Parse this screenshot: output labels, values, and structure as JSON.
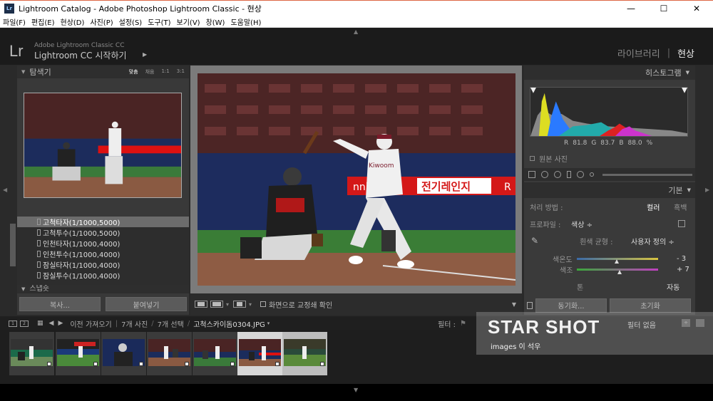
{
  "window": {
    "icon_text": "Lr",
    "title": "Lightroom Catalog - Adobe Photoshop Lightroom Classic - 현상",
    "minimize": "—",
    "maximize": "☐",
    "close": "✕"
  },
  "menu": [
    "파일(F)",
    "편집(E)",
    "현상(D)",
    "사진(P)",
    "설정(S)",
    "도구(T)",
    "보기(V)",
    "창(W)",
    "도움말(H)"
  ],
  "identity": {
    "logo": "Lr",
    "line1": "Adobe Lightroom Classic CC",
    "line2": "Lightroom CC 시작하기",
    "arrow": "▶"
  },
  "modules": {
    "library": "라이브러리",
    "separator": "|",
    "develop": "현상"
  },
  "navigator": {
    "title": "탐색기",
    "zoom_options": [
      "맞춤",
      "채움",
      "1:1",
      "3:1"
    ]
  },
  "presets": [
    {
      "label": "고척타자(1/1000,5000)",
      "selected": true
    },
    {
      "label": "고척투수(1/1000,5000)",
      "selected": false
    },
    {
      "label": "인천타자(1/1000,4000)",
      "selected": false
    },
    {
      "label": "인천투수(1/1000,4000)",
      "selected": false
    },
    {
      "label": "잠실타자(1/1000,4000)",
      "selected": false
    },
    {
      "label": "잠실투수(1/1000,4000)",
      "selected": false
    }
  ],
  "snapshots_title": "스냅숏",
  "left_buttons": {
    "copy": "복사...",
    "paste": "붙여넣기"
  },
  "photo_text": {
    "sponsor_left": "nni",
    "sponsor_mid": "전기레인지",
    "sponsor_right": "R",
    "jersey": "Kiwoom"
  },
  "center_toolbar": {
    "softproof_label": "화면으로 교정쇄 확인"
  },
  "histogram": {
    "title": "히스토그램",
    "r_label": "R",
    "r_value": "81.8",
    "g_label": "G",
    "g_value": "83.7",
    "b_label": "B",
    "b_value": "88.0",
    "percent": "%",
    "original_photo": "원본 사진"
  },
  "basic": {
    "title": "기본",
    "treatment_label": "처리 방법 :",
    "color": "컬러",
    "bw": "흑백",
    "profile_label": "프로파일 :",
    "profile_value": "색상 ÷",
    "wb_label": "흰색 균형 :",
    "wb_value": "사용자 정의 ÷",
    "temp_label": "색온도",
    "temp_value": "- 3",
    "tint_label": "색조",
    "tint_value": "+ 7",
    "tone_label": "톤",
    "auto": "자동"
  },
  "right_buttons": {
    "sync": "동기화...",
    "reset": "초기화"
  },
  "filmstrip_bar": {
    "view1": "1",
    "view2": "2",
    "prev_import": "이전 가져오기",
    "count": "7개 사진",
    "selection": "7개 선택",
    "filename": "고척스카이돔0304.JPG",
    "filter_label": "필터 :",
    "filter_value": "필터 없음"
  },
  "filmstrip": {
    "count": 7,
    "selected_index": 5
  },
  "watermark": {
    "title": "STAR SHOT",
    "subtitle": "images 이 석우"
  }
}
